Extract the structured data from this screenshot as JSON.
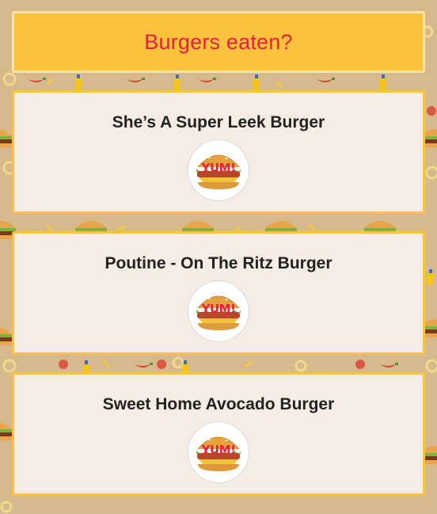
{
  "header": {
    "title": "Burgers eaten?"
  },
  "burgers": [
    {
      "name": "She’s A Super Leek Burger",
      "button_label": "YUM!",
      "icon": "burger-icon"
    },
    {
      "name": "Poutine - On The Ritz Burger",
      "button_label": "YUM!",
      "icon": "burger-icon"
    },
    {
      "name": "Sweet Home Avocado Burger",
      "button_label": "YUM!",
      "icon": "burger-icon"
    }
  ],
  "colors": {
    "header_bg": "#ffc23d",
    "title_red": "#e8203e",
    "card_bg": "#f5ece3",
    "card_border": "#ffc23d",
    "page_bg": "#d6b98c"
  }
}
